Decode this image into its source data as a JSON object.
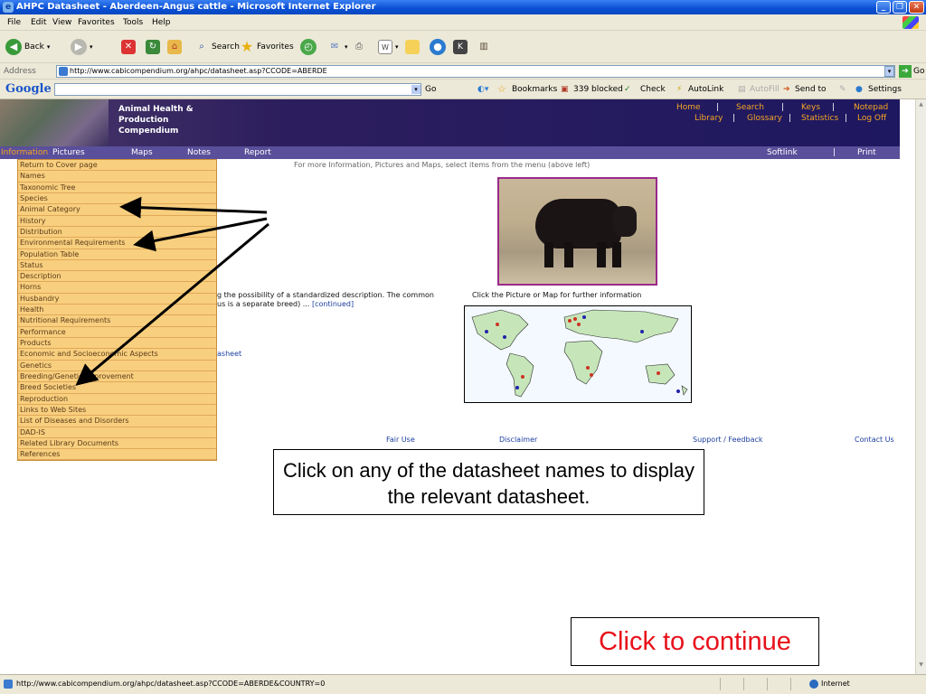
{
  "window": {
    "title": "AHPC Datasheet - Aberdeen-Angus cattle - Microsoft Internet Explorer"
  },
  "menubar": [
    "File",
    "Edit",
    "View",
    "Favorites",
    "Tools",
    "Help"
  ],
  "toolbar": {
    "back": "Back",
    "search": "Search",
    "favorites": "Favorites"
  },
  "address": {
    "label": "Address",
    "url": "http://www.cabicompendium.org/ahpc/datasheet.asp?CCODE=ABERDE",
    "go": "Go"
  },
  "googlebar": {
    "logo": "Google",
    "go": "Go",
    "bookmarks": "Bookmarks",
    "blocked": "339 blocked",
    "check": "Check",
    "autolink": "AutoLink",
    "autofill": "AutoFill",
    "sendto": "Send to",
    "settings": "Settings"
  },
  "site": {
    "title_line1": "Animal Health &",
    "title_line2": "Production",
    "title_line3": "Compendium",
    "toplinks_row1": [
      "Home",
      "Search",
      "Keys",
      "Notepad"
    ],
    "toplinks_row2": [
      "Library",
      "Glossary",
      "Statistics",
      "Log Off"
    ]
  },
  "nav": {
    "items": [
      "Information",
      "Pictures",
      "Maps",
      "Notes",
      "Report"
    ],
    "softlink": "Softlink",
    "print": "Print"
  },
  "menu": [
    "Return to Cover page",
    "Names",
    "Taxonomic Tree",
    "Species",
    "Animal Category",
    "History",
    "Distribution",
    "Environmental Requirements",
    "Population Table",
    "Status",
    "Description",
    "Horns",
    "Husbandry",
    "Health",
    "Nutritional Requirements",
    "Performance",
    "Products",
    "Economic and Socioeconomic Aspects",
    "Genetics",
    "Breeding/Genetic Improvement",
    "Breed Societies",
    "Reproduction",
    "Links to Web Sites",
    "List of Diseases and Disorders",
    "DAD-IS",
    "Related Library Documents",
    "References"
  ],
  "content": {
    "info": "For more Information, Pictures and Maps, select items from the menu (above left)",
    "desc_line1": "g the possibility of a standardized description. The common",
    "desc_line2": "us is a separate breed) ...",
    "continued": "[continued]",
    "sheet_link": "asheet",
    "click_picture": "Click the Picture or Map for further information"
  },
  "footer": [
    "Fair Use",
    "Disclaimer",
    "Support / Feedback",
    "Contact Us"
  ],
  "callouts": {
    "note": "Click on any of the datasheet names to display the relevant datasheet.",
    "continue": "Click to continue"
  },
  "status": {
    "url": "http://www.cabicompendium.org/ahpc/datasheet.asp?CCODE=ABERDE&COUNTRY=0",
    "zone": "Internet"
  }
}
